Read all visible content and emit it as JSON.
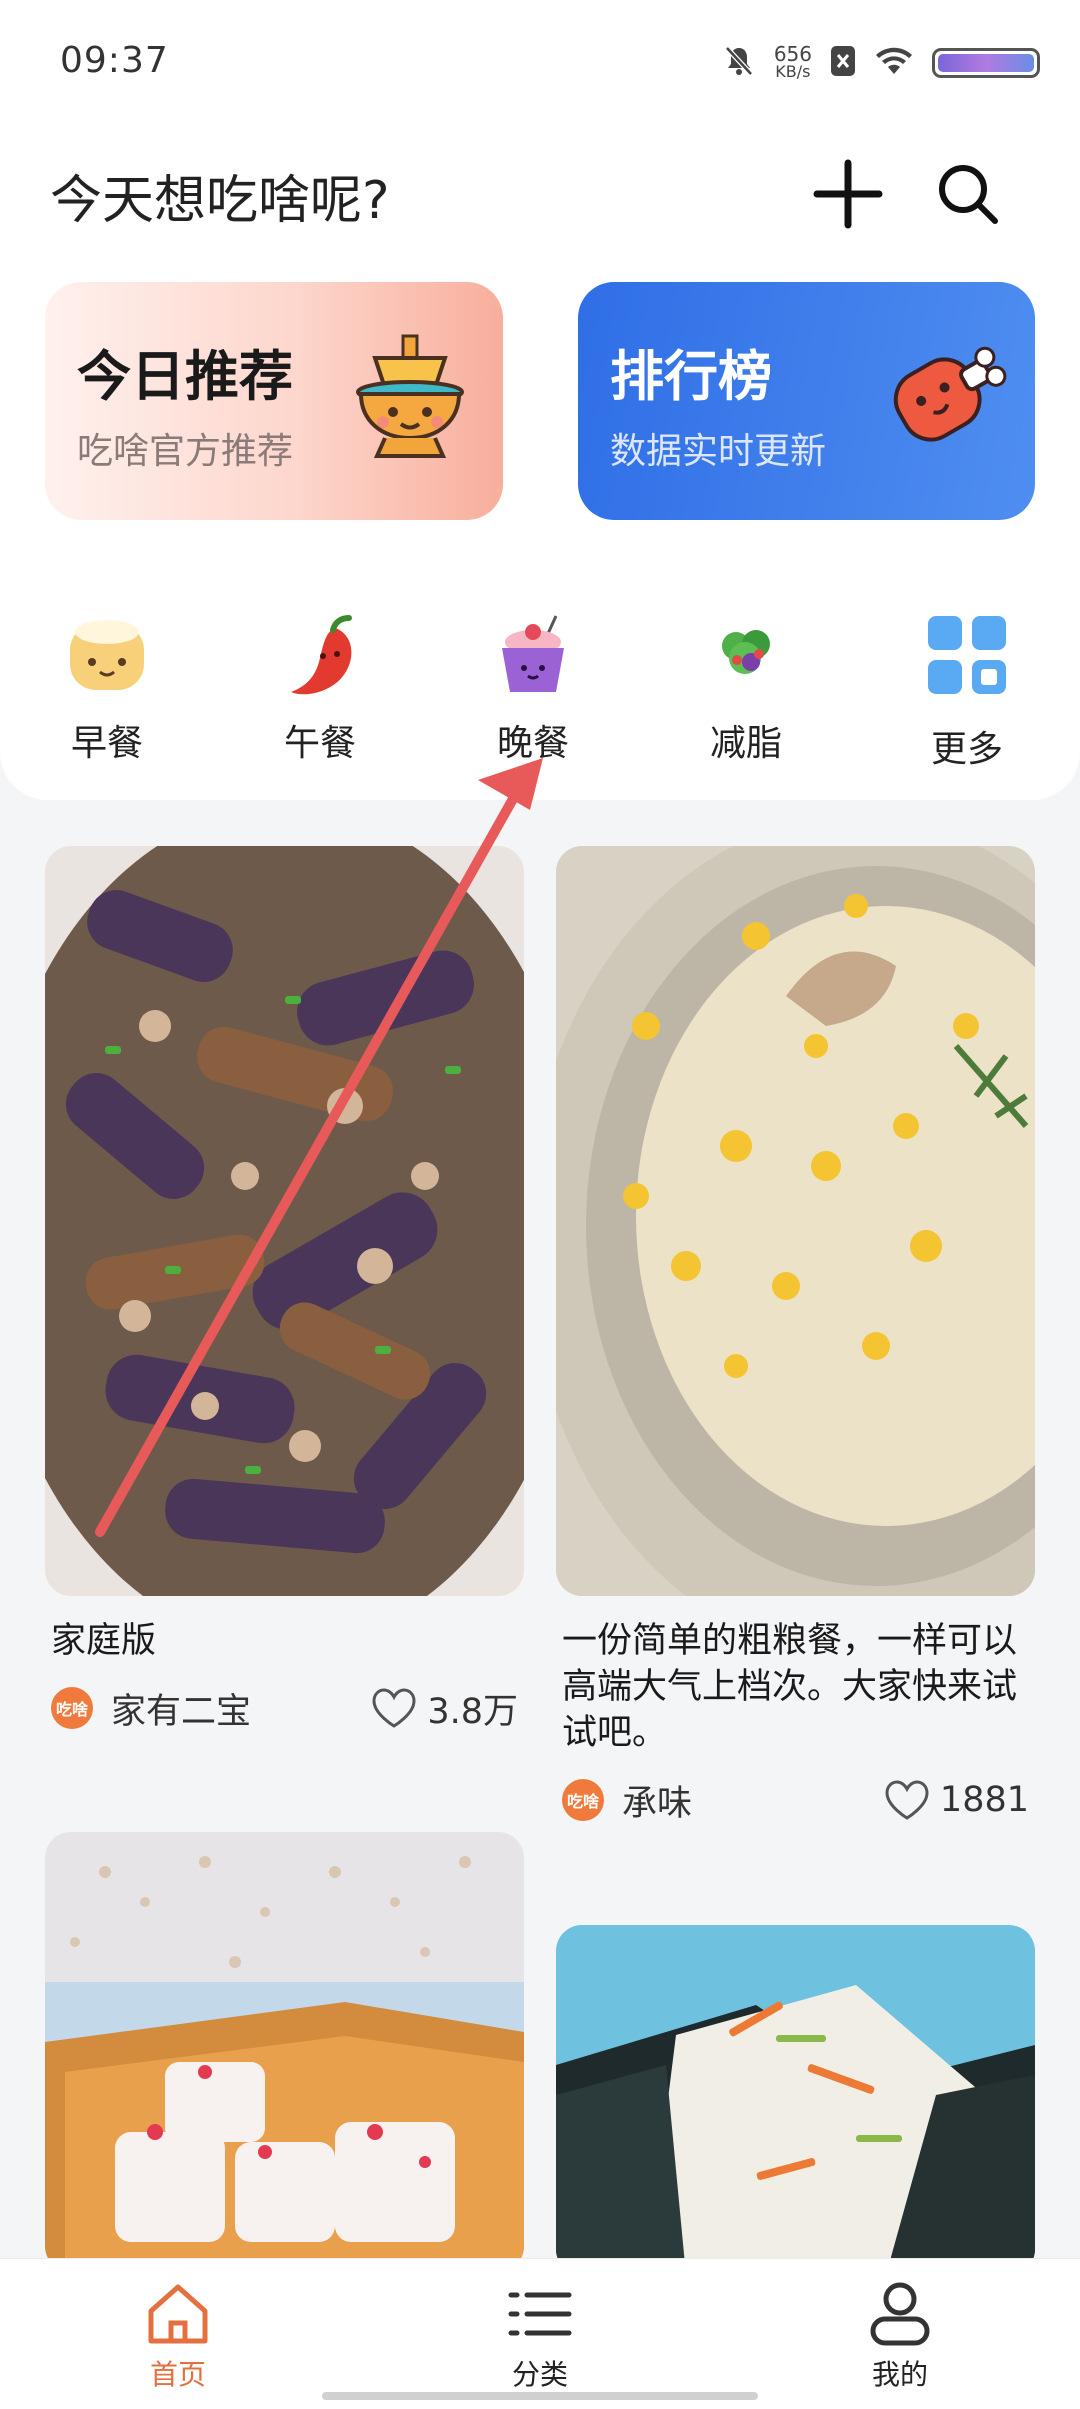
{
  "status": {
    "time": "09:37",
    "speed_value": "656",
    "speed_unit": "KB/s"
  },
  "header": {
    "title": "今天想吃啥呢?"
  },
  "banners": [
    {
      "title": "今日推荐",
      "subtitle": "吃啥官方推荐"
    },
    {
      "title": "排行榜",
      "subtitle": "数据实时更新"
    }
  ],
  "categories": [
    {
      "label": "早餐"
    },
    {
      "label": "午餐"
    },
    {
      "label": "晚餐"
    },
    {
      "label": "减脂"
    },
    {
      "label": "更多"
    }
  ],
  "feed": [
    {
      "title": "家庭版",
      "author": "家有二宝",
      "likes": "3.8万",
      "avatar_text": "吃啥"
    },
    {
      "title": "一份简单的粗粮餐，一样可以高端大气上档次。大家快来试试吧。",
      "author": "承味",
      "likes": "1881",
      "avatar_text": "吃啥"
    },
    {
      "title": "",
      "author": "",
      "likes": ""
    },
    {
      "title": "",
      "author": "",
      "likes": ""
    }
  ],
  "tabs": [
    {
      "label": "首页",
      "active": true
    },
    {
      "label": "分类",
      "active": false
    },
    {
      "label": "我的",
      "active": false
    }
  ],
  "colors": {
    "accent": "#e3703e",
    "rank_blue": "#3a78ea",
    "annotation_arrow": "#e85a5a"
  }
}
